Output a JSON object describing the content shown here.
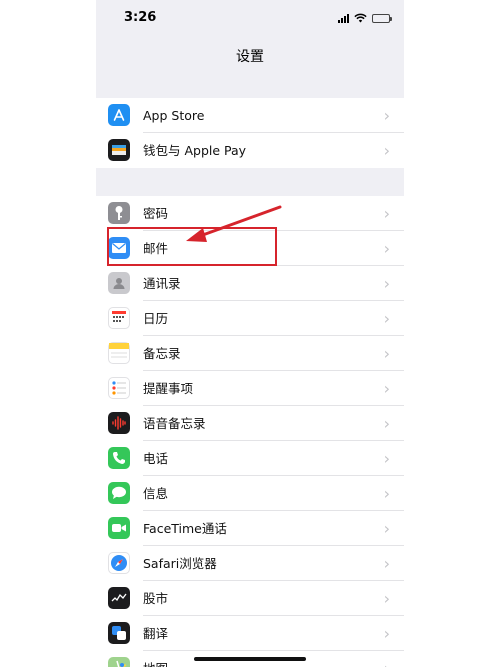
{
  "status": {
    "time": "3:26"
  },
  "nav": {
    "title": "设置"
  },
  "groups": [
    {
      "items": [
        {
          "label": "App Store",
          "icon": "app-store-icon",
          "color": "#1f8ff2",
          "glyph": "A"
        },
        {
          "label": "钱包与 Apple Pay",
          "icon": "wallet-icon",
          "color": "#1c1c1e",
          "glyph": "▤"
        }
      ]
    },
    {
      "items": [
        {
          "label": "密码",
          "icon": "key-icon",
          "color": "#8e8e93",
          "glyph": "⚿"
        },
        {
          "label": "邮件",
          "icon": "mail-icon",
          "color": "#2f8df5",
          "glyph": "✉"
        },
        {
          "label": "通讯录",
          "icon": "contacts-icon",
          "color": "#b9b9bd",
          "glyph": "☺"
        },
        {
          "label": "日历",
          "icon": "calendar-icon",
          "color": "#ffffff",
          "glyph": "▦"
        },
        {
          "label": "备忘录",
          "icon": "notes-icon",
          "color": "#ffd23b",
          "glyph": "≡"
        },
        {
          "label": "提醒事项",
          "icon": "reminders-icon",
          "color": "#ffffff",
          "glyph": "⋮"
        },
        {
          "label": "语音备忘录",
          "icon": "voice-memos-icon",
          "color": "#1c1c1e",
          "glyph": "♪"
        },
        {
          "label": "电话",
          "icon": "phone-icon",
          "color": "#34c759",
          "glyph": "✆"
        },
        {
          "label": "信息",
          "icon": "messages-icon",
          "color": "#34c759",
          "glyph": "✉"
        },
        {
          "label": "FaceTime通话",
          "icon": "facetime-icon",
          "color": "#34c759",
          "glyph": "▶"
        },
        {
          "label": "Safari浏览器",
          "icon": "safari-icon",
          "color": "#2f8df5",
          "glyph": "⊛"
        },
        {
          "label": "股市",
          "icon": "stocks-icon",
          "color": "#1c1c1e",
          "glyph": "∿"
        },
        {
          "label": "翻译",
          "icon": "translate-icon",
          "color": "#1c1c1e",
          "glyph": "文"
        },
        {
          "label": "地图",
          "icon": "maps-icon",
          "color": "#7fc67d",
          "glyph": "⌖"
        }
      ]
    }
  ],
  "chevron": "›",
  "annotation": {
    "highlight_color": "#d6242c"
  }
}
